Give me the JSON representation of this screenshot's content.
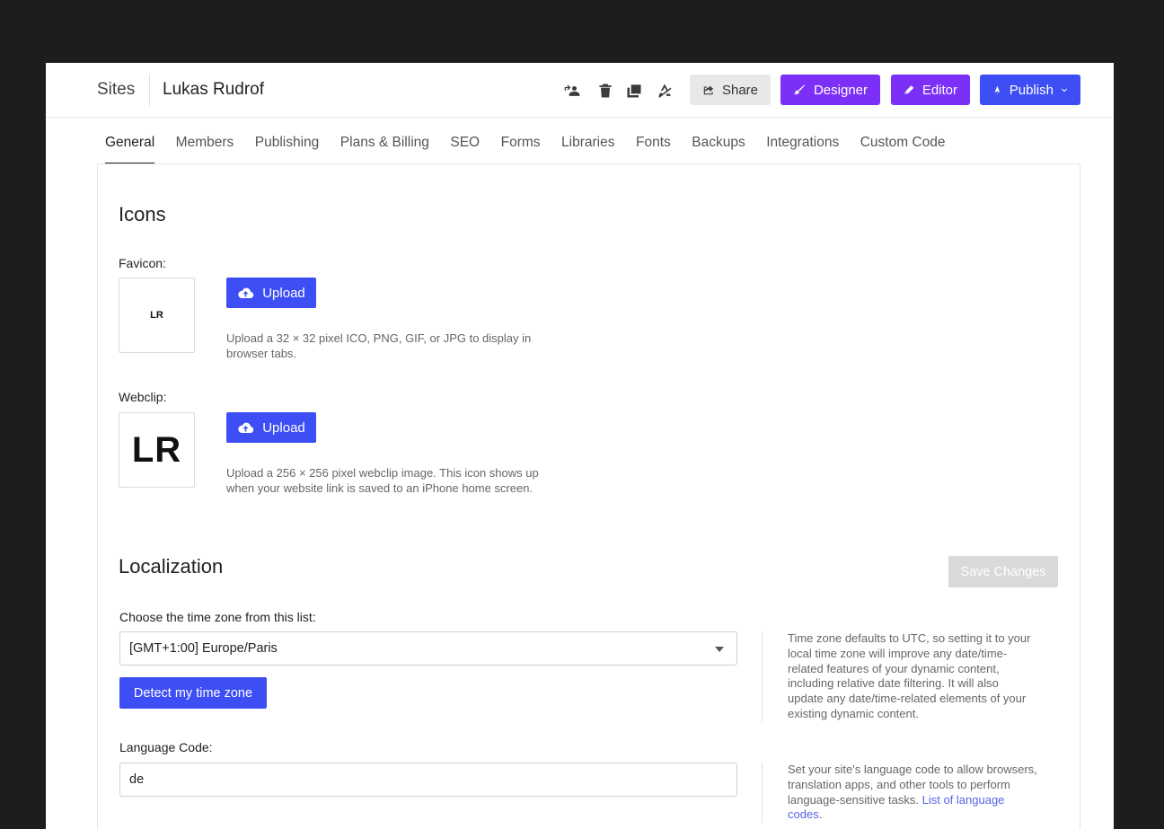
{
  "header": {
    "brand": "Sites",
    "site_name": "Lukas Rudrof",
    "tools": [
      {
        "name": "transfer-site-icon"
      },
      {
        "name": "trash-icon"
      },
      {
        "name": "duplicate-icon"
      },
      {
        "name": "unpublish-icon"
      }
    ],
    "buttons": {
      "share": "Share",
      "designer": "Designer",
      "editor": "Editor",
      "publish": "Publish"
    },
    "colors": {
      "designer": "#7b2ff7",
      "publish": "#3d4ef5"
    }
  },
  "tabs": [
    {
      "label": "General",
      "active": true
    },
    {
      "label": "Members"
    },
    {
      "label": "Publishing"
    },
    {
      "label": "Plans & Billing"
    },
    {
      "label": "SEO"
    },
    {
      "label": "Forms"
    },
    {
      "label": "Libraries"
    },
    {
      "label": "Fonts"
    },
    {
      "label": "Backups"
    },
    {
      "label": "Integrations"
    },
    {
      "label": "Custom Code"
    }
  ],
  "icons_section": {
    "title": "Icons",
    "favicon": {
      "label": "Favicon:",
      "preview": "LR",
      "upload_label": "Upload",
      "help_line1": "Upload a 32 × 32 pixel ICO, PNG, GIF, or JPG to display in",
      "help_line2": "browser tabs."
    },
    "webclip": {
      "label": "Webclip:",
      "preview": "LR",
      "upload_label": "Upload",
      "help_line1": "Upload a 256 × 256 pixel webclip image. This icon shows up",
      "help_line2": "when your website link is saved to an iPhone home screen."
    }
  },
  "localization": {
    "title": "Localization",
    "save_label": "Save Changes",
    "timezone": {
      "label": "Choose the time zone from this list:",
      "selected": "[GMT+1:00] Europe/Paris",
      "detect_label": "Detect my time zone",
      "help_lines": [
        "Time zone defaults to UTC, so setting it to your",
        "local time zone will improve any date/time-",
        "related features of your dynamic content,",
        "including relative date filtering. It will also",
        "update any date/time-related elements of your",
        "existing dynamic content."
      ]
    },
    "language": {
      "label": "Language Code:",
      "value": "de",
      "help_line1": "Set your site's language code to allow browsers,",
      "help_line2": "translation apps, and other tools to perform",
      "help_line3": "language-sensitive tasks.",
      "link_part1": "List of language",
      "link_part2": "codes",
      "help_end": "."
    }
  }
}
